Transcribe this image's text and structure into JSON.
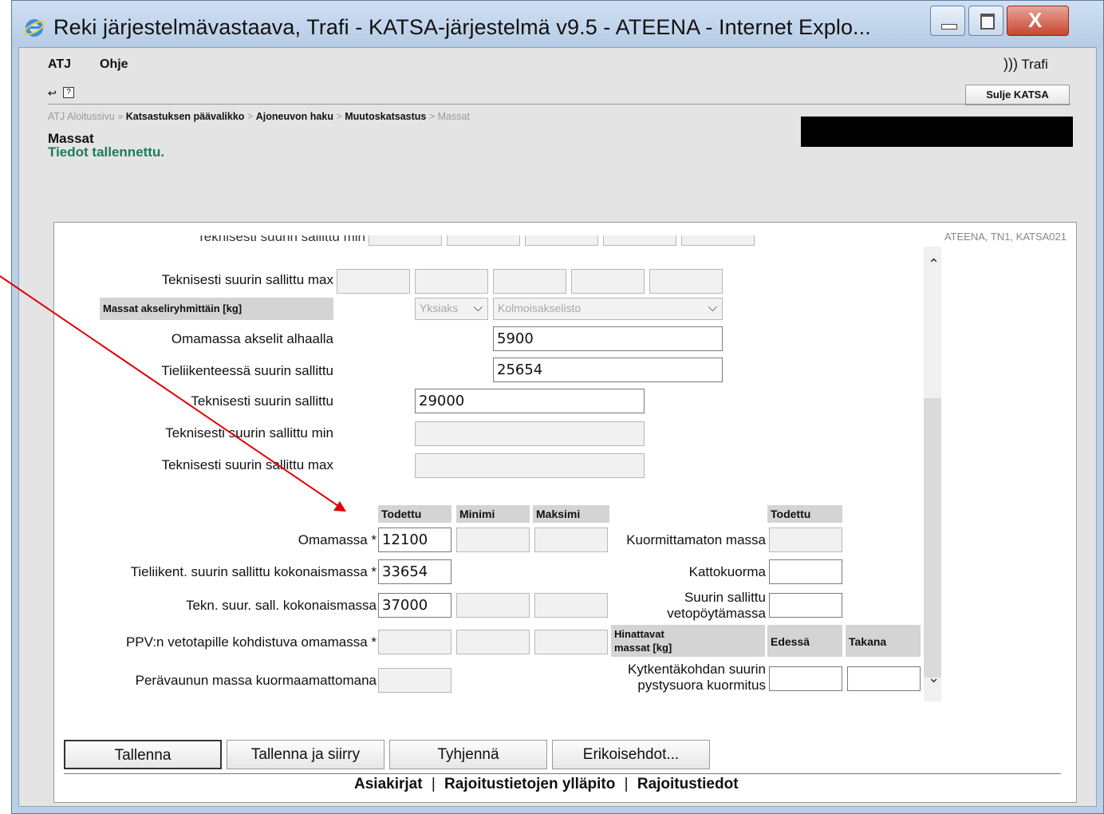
{
  "window": {
    "title": "Reki järjestelmävastaava, Trafi - KATSA-järjestelmä v9.5 - ATEENA - Internet Explo..."
  },
  "menu": {
    "atj": "ATJ",
    "ohje": "Ohje",
    "brand": "Trafi",
    "help_box": "?",
    "close_button": "Sulje KATSA"
  },
  "breadcrumb": {
    "items": [
      "ATJ Aloitussivu",
      "Katsastuksen päävalikko",
      "Ajoneuvon haku",
      "Muutoskatsastus",
      "Massat"
    ],
    "sep1": "»",
    "sep": ">"
  },
  "page": {
    "title": "Massat",
    "status": "Tiedot tallennettu.",
    "system_info": "ATEENA, TN1, KATSA021"
  },
  "form": {
    "row_min_top": "Teknisesti suurin sallittu min",
    "row_max_top": "Teknisesti suurin sallittu max",
    "group_header": "Massat akseliryhmittäin [kg]",
    "group_select1": "Yksiaks",
    "group_select2": "Kolmoisakselisto",
    "omamassa_alhaalla": {
      "label": "Omamassa akselit alhaalla",
      "value": "5900"
    },
    "tieliikenteessa": {
      "label": "Tieliikenteessä suurin sallittu",
      "value": "25654"
    },
    "teknisesti": {
      "label": "Teknisesti suurin sallittu",
      "value": "29000"
    },
    "tek_min": {
      "label": "Teknisesti suurin sallittu min",
      "value": ""
    },
    "tek_max": {
      "label": "Teknisesti suurin sallittu max",
      "value": ""
    },
    "headers": {
      "todettu": "Todettu",
      "minimi": "Minimi",
      "maksimi": "Maksimi",
      "todettu2": "Todettu"
    },
    "omamassa": {
      "label": "Omamassa *",
      "value": "12100"
    },
    "tieliikent_kokonais": {
      "label": "Tieliikent. suurin sallittu kokonaismassa *",
      "value": "33654"
    },
    "tekn_kokonais": {
      "label": "Tekn. suur. sall. kokonaismassa",
      "value": "37000"
    },
    "ppv": {
      "label": "PPV:n vetotapille kohdistuva omamassa *",
      "value": ""
    },
    "peravaunu": {
      "label": "Perävaunun massa kuormaamattomana",
      "value": ""
    },
    "kuormittamaton": {
      "label": "Kuormittamaton massa",
      "value": ""
    },
    "kattokuorma": {
      "label": "Kattokuorma",
      "value": ""
    },
    "vetopoyta": {
      "label_line1": "Suurin sallittu",
      "label_line2": "vetopöytämassa",
      "value": ""
    },
    "hinattavat": {
      "header_line1": "Hinattavat",
      "header_line2": "massat [kg]",
      "edessa": "Edessä",
      "takana": "Takana"
    },
    "kytkenta": {
      "label_line1": "Kytkentäkohdan suurin",
      "label_line2": "pystysuora kuormitus",
      "edessa_value": "",
      "takana_value": ""
    }
  },
  "buttons": {
    "tallenna": "Tallenna",
    "tallenna_siirry": "Tallenna ja siirry",
    "tyhjenna": "Tyhjennä",
    "erikoisehdot": "Erikoisehdot..."
  },
  "footer_links": {
    "asiakirjat": "Asiakirjat",
    "sep": "|",
    "rajoitus_yllapito": "Rajoitustietojen ylläpito",
    "rajoitustiedot": "Rajoitustiedot"
  },
  "colors": {
    "status_green": "#1f7a5c",
    "annotation_red": "#e00000"
  }
}
